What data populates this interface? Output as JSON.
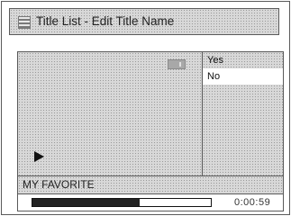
{
  "title_bar": {
    "title": "Title List - Edit Title Name",
    "icon": "title-list-icon"
  },
  "preview": {
    "badge_icon": "marker-icon",
    "play_icon": "play-icon"
  },
  "menu": {
    "items": [
      "Yes",
      "No"
    ],
    "selected_index": 1
  },
  "title_name": "MY FAVORITE",
  "playback": {
    "progress_fraction": 0.6,
    "time": "0:00:59"
  },
  "colors": {
    "background_pattern": "#d8d8d8",
    "border": "#5a5a5a",
    "progress_fill": "#222222",
    "selected_item": "#ffffff"
  }
}
